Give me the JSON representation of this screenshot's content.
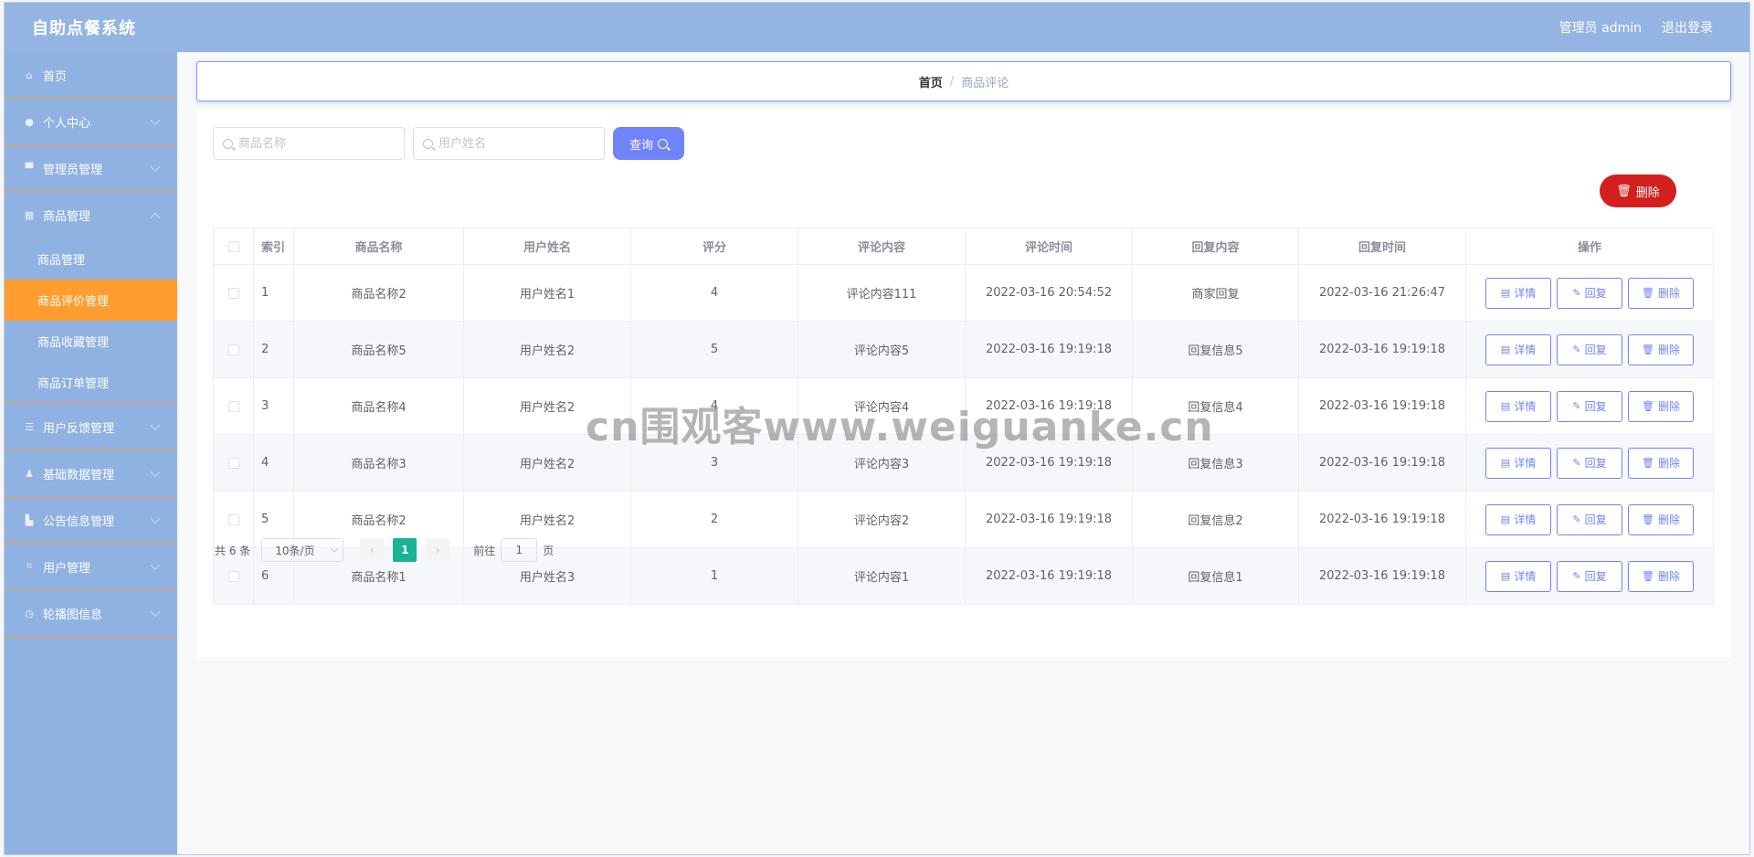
{
  "app": {
    "title": "自助点餐系统"
  },
  "header": {
    "user_label": "管理员 admin",
    "logout_label": "退出登录"
  },
  "sidebar": {
    "items": [
      {
        "label": "首页",
        "icon": "home-icon"
      },
      {
        "label": "个人中心",
        "icon": "user-icon"
      },
      {
        "label": "管理员管理",
        "icon": "admin-icon"
      },
      {
        "label": "商品管理",
        "icon": "grid-icon"
      },
      {
        "label": "用户反馈管理",
        "icon": "list-icon"
      },
      {
        "label": "基础数据管理",
        "icon": "person-icon"
      },
      {
        "label": "公告信息管理",
        "icon": "bag-icon"
      },
      {
        "label": "用户管理",
        "icon": "crop-icon"
      },
      {
        "label": "轮播图信息",
        "icon": "clock-icon"
      }
    ],
    "submenu": [
      {
        "label": "商品管理"
      },
      {
        "label": "商品评价管理"
      },
      {
        "label": "商品收藏管理"
      },
      {
        "label": "商品订单管理"
      }
    ]
  },
  "breadcrumb": {
    "home": "首页",
    "separator": "/",
    "current": "商品评论"
  },
  "search": {
    "product_placeholder": "商品名称",
    "user_placeholder": "用户姓名",
    "query_label": "查询"
  },
  "actions": {
    "delete_label": "删除"
  },
  "table": {
    "headers": [
      "索引",
      "商品名称",
      "用户姓名",
      "评分",
      "评论内容",
      "评论时间",
      "回复内容",
      "回复时间",
      "操作"
    ],
    "rows": [
      {
        "index": "1",
        "product": "商品名称2",
        "user": "用户姓名1",
        "score": "4",
        "comment": "评论内容111",
        "comment_time": "2022-03-16 20:54:52",
        "reply": "商家回复",
        "reply_time": "2022-03-16 21:26:47"
      },
      {
        "index": "2",
        "product": "商品名称5",
        "user": "用户姓名2",
        "score": "5",
        "comment": "评论内容5",
        "comment_time": "2022-03-16 19:19:18",
        "reply": "回复信息5",
        "reply_time": "2022-03-16 19:19:18"
      },
      {
        "index": "3",
        "product": "商品名称4",
        "user": "用户姓名2",
        "score": "4",
        "comment": "评论内容4",
        "comment_time": "2022-03-16 19:19:18",
        "reply": "回复信息4",
        "reply_time": "2022-03-16 19:19:18"
      },
      {
        "index": "4",
        "product": "商品名称3",
        "user": "用户姓名2",
        "score": "3",
        "comment": "评论内容3",
        "comment_time": "2022-03-16 19:19:18",
        "reply": "回复信息3",
        "reply_time": "2022-03-16 19:19:18"
      },
      {
        "index": "5",
        "product": "商品名称2",
        "user": "用户姓名2",
        "score": "2",
        "comment": "评论内容2",
        "comment_time": "2022-03-16 19:19:18",
        "reply": "回复信息2",
        "reply_time": "2022-03-16 19:19:18"
      },
      {
        "index": "6",
        "product": "商品名称1",
        "user": "用户姓名3",
        "score": "1",
        "comment": "评论内容1",
        "comment_time": "2022-03-16 19:19:18",
        "reply": "回复信息1",
        "reply_time": "2022-03-16 19:19:18"
      }
    ],
    "row_actions": {
      "detail": "详情",
      "reply": "回复",
      "delete": "删除"
    }
  },
  "pagination": {
    "total_text": "共 6 条",
    "page_size": "10条/页",
    "prev": "‹",
    "current_page": "1",
    "next": "›",
    "goto_label": "前往",
    "goto_value": "1",
    "page_suffix": "页"
  },
  "watermark": {
    "text": "cn围观客www.weiguanke.cn"
  },
  "colors": {
    "header_bg": "#94b4e3",
    "sidebar_bg": "#90b2e2",
    "active_menu": "#ff9e2e",
    "primary": "#6f85f7",
    "danger": "#d41f1f",
    "page_active": "#1ab394"
  }
}
